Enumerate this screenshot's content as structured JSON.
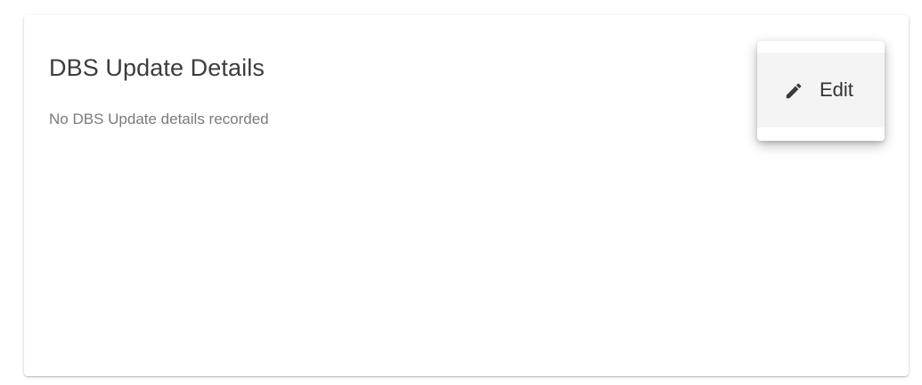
{
  "card": {
    "title": "DBS Update Details",
    "empty_message": "No DBS Update details recorded"
  },
  "menu": {
    "edit_label": "Edit",
    "edit_icon": "pencil-icon"
  },
  "colors": {
    "title": "#3c3c3c",
    "muted_text": "#7a7a7a",
    "menu_item_bg": "#f4f4f4"
  }
}
